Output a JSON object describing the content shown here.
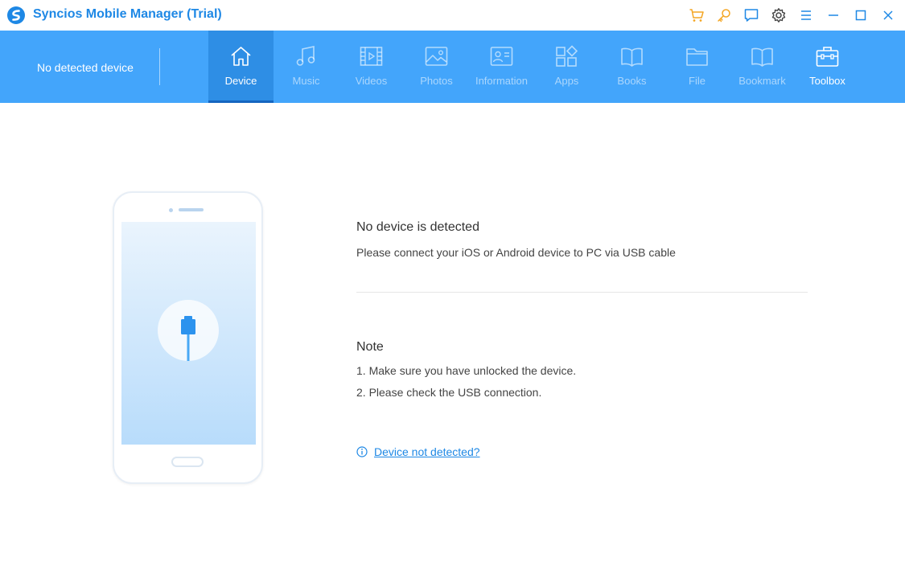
{
  "app": {
    "title": "Syncios Mobile Manager (Trial)",
    "accent_color": "#1e88e5",
    "nav_color": "#43a5fb"
  },
  "titlebar_icons": [
    "cart-icon",
    "key-icon",
    "feedback-icon",
    "gear-icon",
    "menu-icon",
    "minimize-icon",
    "maximize-icon",
    "close-icon"
  ],
  "nav": {
    "device_status": "No detected device",
    "tabs": [
      {
        "label": "Device",
        "icon": "home-icon",
        "active": true
      },
      {
        "label": "Music",
        "icon": "music-icon",
        "active": false
      },
      {
        "label": "Videos",
        "icon": "film-icon",
        "active": false
      },
      {
        "label": "Photos",
        "icon": "photo-icon",
        "active": false
      },
      {
        "label": "Information",
        "icon": "contact-card-icon",
        "active": false
      },
      {
        "label": "Apps",
        "icon": "apps-icon",
        "active": false
      },
      {
        "label": "Books",
        "icon": "book-icon",
        "active": false
      },
      {
        "label": "File",
        "icon": "folder-icon",
        "active": false
      },
      {
        "label": "Bookmark",
        "icon": "bookmark-book-icon",
        "active": false
      },
      {
        "label": "Toolbox",
        "icon": "toolbox-icon",
        "active": false
      }
    ]
  },
  "main": {
    "heading": "No device is detected",
    "subtext": "Please connect your iOS or Android device to PC via USB cable",
    "note": {
      "title": "Note",
      "items": [
        "1. Make sure you have unlocked the device.",
        "2. Please check the USB connection."
      ]
    },
    "help_link": "Device not detected?"
  }
}
